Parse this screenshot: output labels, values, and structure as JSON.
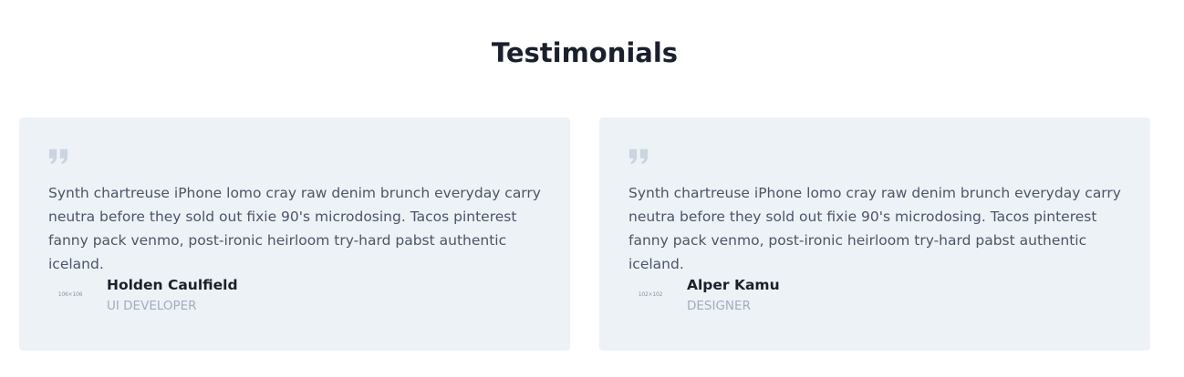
{
  "section": {
    "title": "Testimonials"
  },
  "testimonials": [
    {
      "quote": "Synth chartreuse iPhone lomo cray raw denim brunch everyday carry neutra before they sold out fixie 90's microdosing. Tacos pinterest fanny pack venmo, post-ironic heirloom try-hard pabst authentic iceland.",
      "avatar_text": "106×106",
      "name": "Holden Caulfield",
      "role": "UI DEVELOPER"
    },
    {
      "quote": "Synth chartreuse iPhone lomo cray raw denim brunch everyday carry neutra before they sold out fixie 90's microdosing. Tacos pinterest fanny pack venmo, post-ironic heirloom try-hard pabst authentic iceland.",
      "avatar_text": "102×102",
      "name": "Alper Kamu",
      "role": "DESIGNER"
    }
  ],
  "colors": {
    "card_background": "#edf2f7",
    "quote_icon": "#cbd5e0",
    "body_text": "#4a5568",
    "role_text": "#a0aec0",
    "heading_text": "#1a202c"
  },
  "icons": {
    "quote": "quote-icon"
  }
}
